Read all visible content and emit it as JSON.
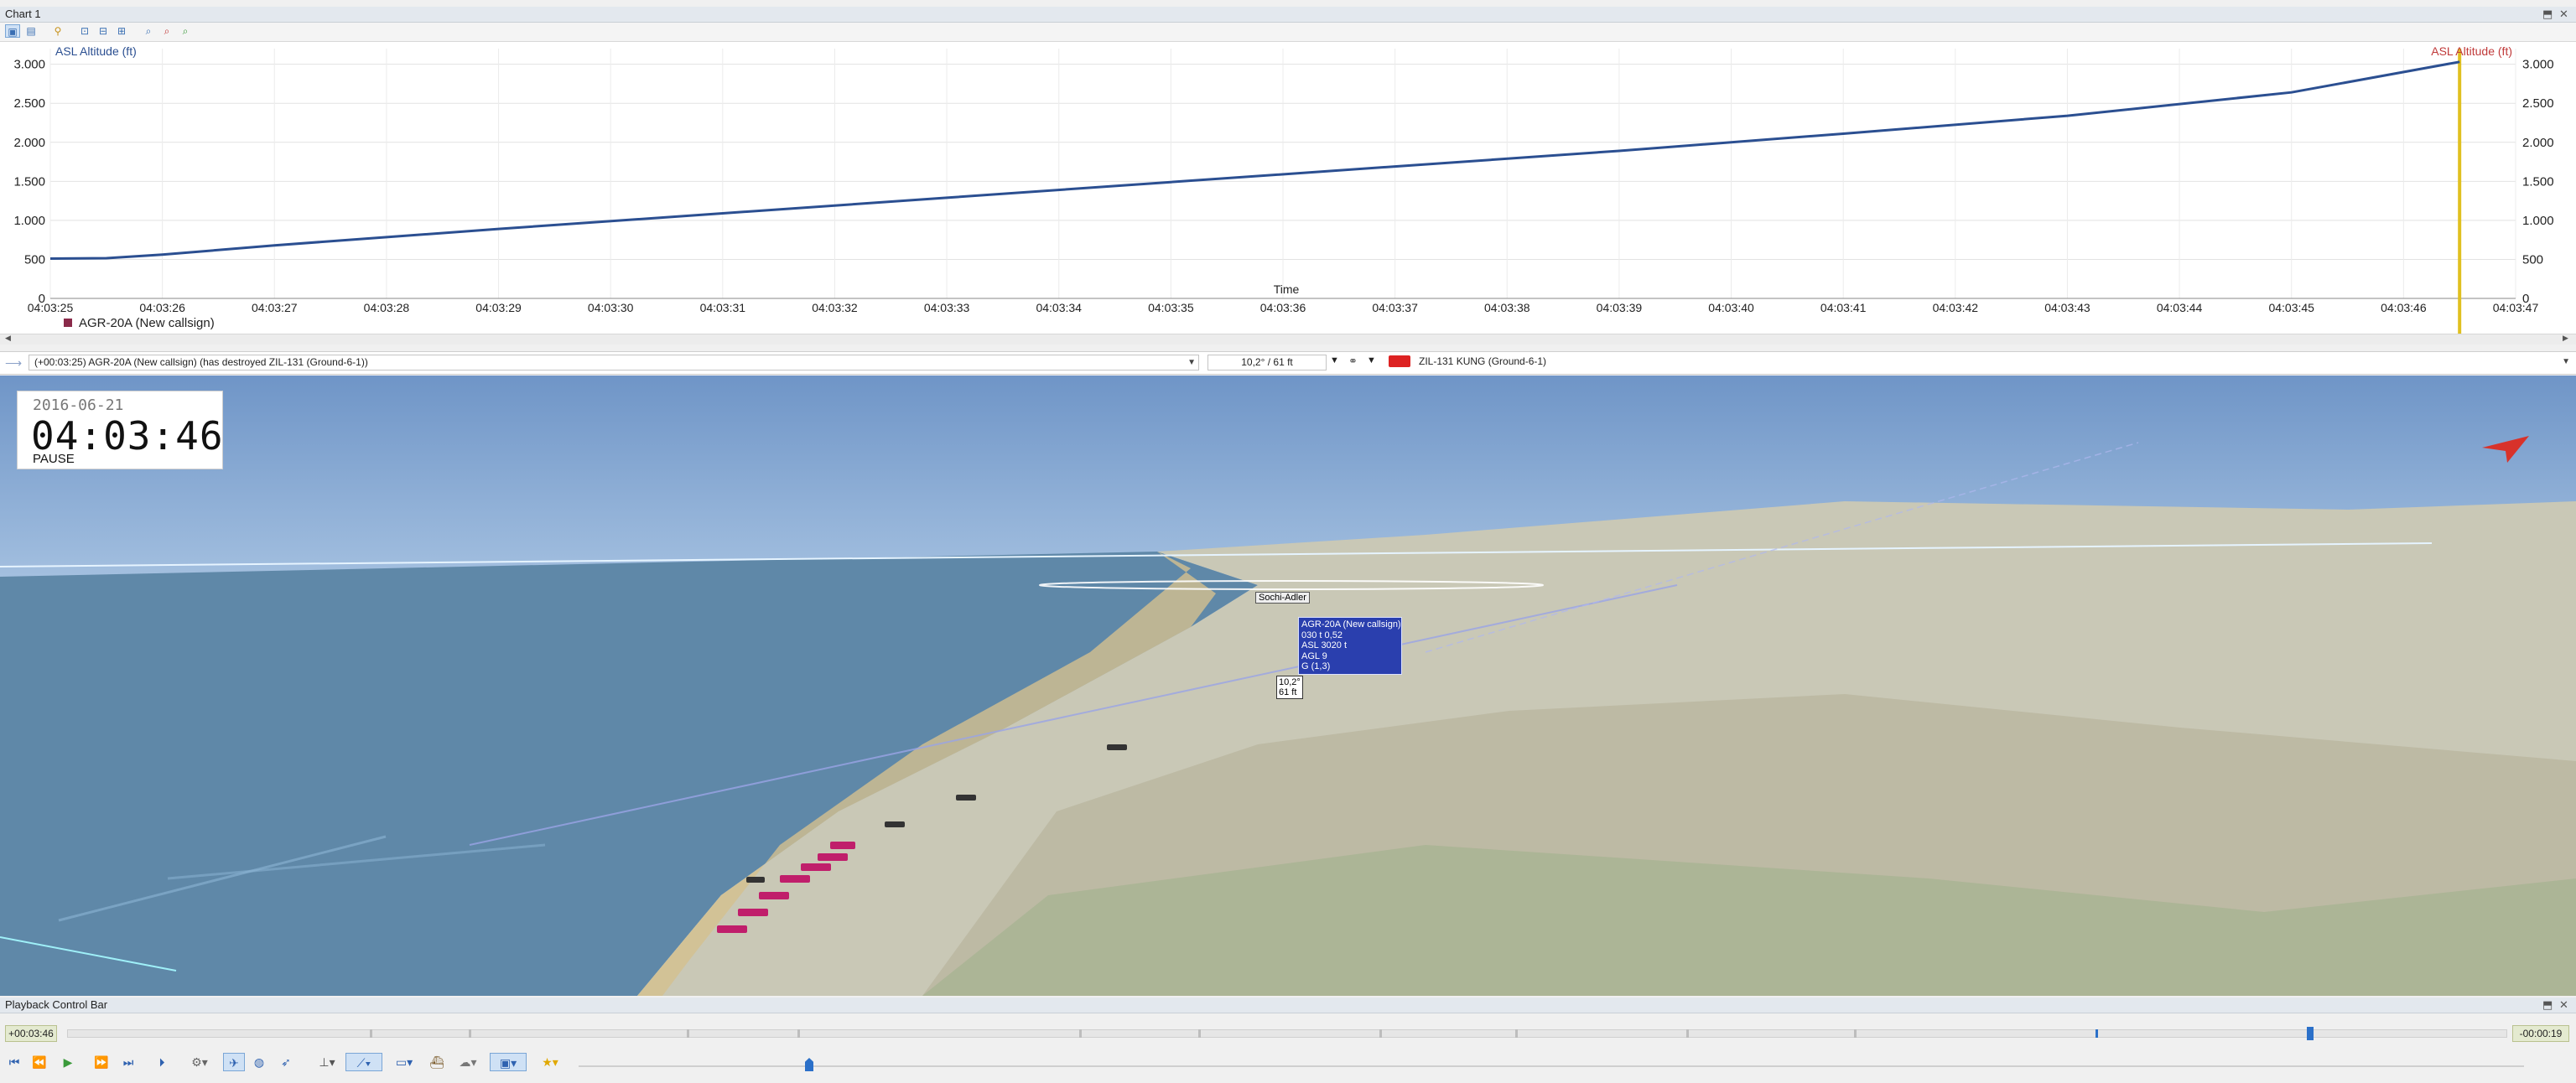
{
  "chart": {
    "window_title": "Chart 1",
    "close_glyph": "✕",
    "pin_glyph": "⬣",
    "toolbar_icons": [
      "view-mode-1-icon",
      "view-mode-2-icon",
      "key-icon",
      "zoom-fit-icon",
      "zoom-x-icon",
      "zoom-y-icon",
      "zoom-in-icon",
      "zoom-out-icon",
      "zoom-reset-icon"
    ],
    "legend_left": "ASL Altitude (ft)",
    "legend_right": "ASL Altitude (ft)",
    "x_axis_label": "Time",
    "series_label": "AGR-20A (New callsign)",
    "accent_color": "#2b4f91",
    "cursor_color": "#e0c020"
  },
  "chart_data": {
    "type": "line",
    "xlabel": "Time",
    "ylabel": "ASL Altitude (ft)",
    "x_ticks": [
      "04:03:25",
      "04:03:26",
      "04:03:27",
      "04:03:28",
      "04:03:29",
      "04:03:30",
      "04:03:31",
      "04:03:32",
      "04:03:33",
      "04:03:34",
      "04:03:35",
      "04:03:36",
      "04:03:37",
      "04:03:38",
      "04:03:39",
      "04:03:40",
      "04:03:41",
      "04:03:42",
      "04:03:43",
      "04:03:44",
      "04:03:45",
      "04:03:46",
      "04:03:47"
    ],
    "y_ticks": [
      "0",
      "500",
      "1.000",
      "1.500",
      "2.000",
      "2.500",
      "3.000"
    ],
    "ylim": [
      0,
      3200
    ],
    "xlim": [
      0,
      22
    ],
    "series": [
      {
        "name": "AGR-20A (New callsign)",
        "x": [
          0,
          0.5,
          1,
          2,
          4,
          6,
          8,
          10,
          12,
          14,
          16,
          18,
          20,
          21.5
        ],
        "y": [
          510,
          515,
          560,
          680,
          890,
          1090,
          1290,
          1490,
          1690,
          1890,
          2110,
          2340,
          2640,
          3030
        ]
      }
    ],
    "cursor_x": 21.5,
    "grid": true
  },
  "eventbar": {
    "event_text": "(+00:03:25) AGR-20A (New callsign) (has destroyed ZIL-131 (Ground-6-1))",
    "measure_value": "10,2° / 61 ft",
    "target_text": "ZIL-131 KUNG (Ground-6-1)"
  },
  "view3d": {
    "date": "2016-06-21",
    "time": "04:03:46",
    "state": "PAUSE",
    "place_label": "Sochi-Adler",
    "info_lines": [
      "AGR-20A (New callsign)",
      "030 t 0,52",
      "ASL 3020 t",
      "AGL 9",
      "G (1,3)"
    ],
    "dist_lines": [
      "10,2°",
      "61 ft"
    ],
    "north_arrow_color": "#d8322a"
  },
  "playback": {
    "window_title": "Playback Control Bar",
    "elapsed": "+00:03:46",
    "remaining": "-00:00:19",
    "buttons": [
      "skip-start-icon",
      "step-back-icon",
      "play-icon",
      "step-forward-icon",
      "skip-end-icon",
      "record-icon",
      "camera-icon",
      "aircraft-icon",
      "globe-icon",
      "missile-icon",
      "axes-icon",
      "ruler-icon",
      "terrain-icon",
      "ship-icon",
      "cloud-icon",
      "display-icon",
      "star-icon"
    ]
  }
}
